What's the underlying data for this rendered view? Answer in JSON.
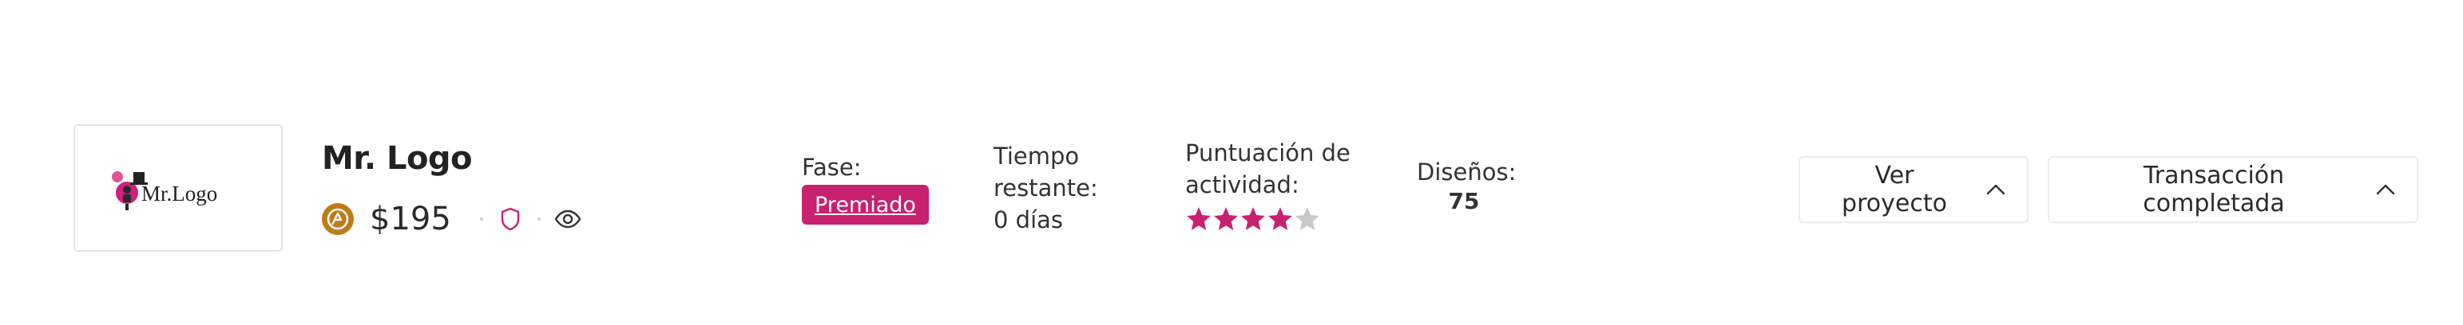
{
  "project": {
    "logo_text": "Mr.Logo",
    "title": "Mr. Logo",
    "price": "$195",
    "icons": {
      "currency": "currency-coin-icon",
      "guarantee": "shield-icon",
      "visibility": "eye-icon"
    }
  },
  "phase": {
    "label": "Fase:",
    "value": "Premiado",
    "badge_color": "#c8216f"
  },
  "time_left": {
    "label": "Tiempo restante:",
    "value": "0 días"
  },
  "activity": {
    "label": "Puntuación de actividad:",
    "rating": 4,
    "max": 5,
    "star_color": "#c8216f",
    "empty_star_color": "#c9c9c9"
  },
  "designs": {
    "label": "Diseños:",
    "count": "75"
  },
  "actions": {
    "view_project": "Ver proyecto",
    "transaction": "Transacción completada"
  }
}
